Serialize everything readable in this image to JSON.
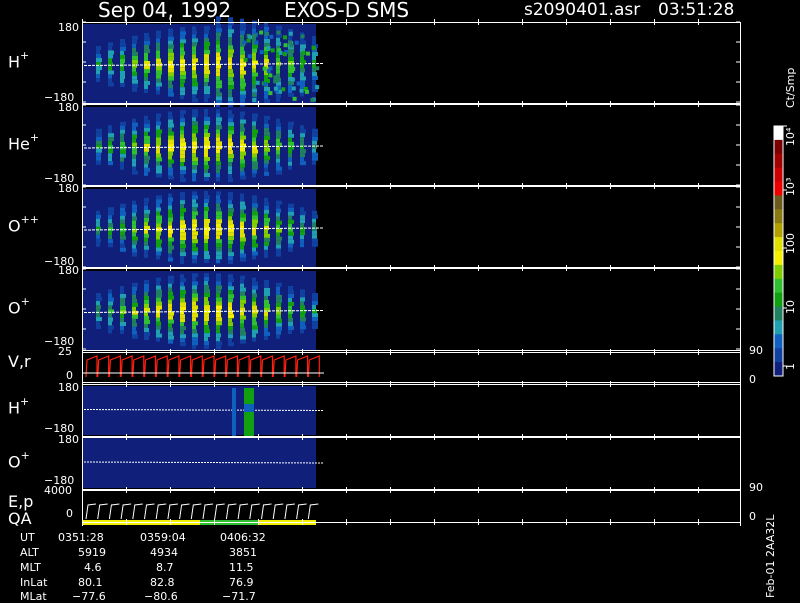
{
  "header": {
    "date": "Sep 04, 1992",
    "instrument": "EXOS-D SMS",
    "file": "s2090401.asr",
    "time": "03:51:28"
  },
  "panels": [
    {
      "species": "H",
      "charge": "+",
      "ymax": "180",
      "ymin": "−180"
    },
    {
      "species": "He",
      "charge": "+",
      "ymax": "180",
      "ymin": "−180"
    },
    {
      "species": "O",
      "charge": "++",
      "ymax": "180",
      "ymin": "−180"
    },
    {
      "species": "O",
      "charge": "+",
      "ymax": "180",
      "ymin": "−180"
    }
  ],
  "vr_panel": {
    "label": "V,r",
    "left_top": "25",
    "left_bottom": "0",
    "right_top": "90",
    "right_bottom": "0"
  },
  "small_panels": [
    {
      "species": "H",
      "charge": "+",
      "ymax": "180",
      "ymin": "−180"
    },
    {
      "species": "O",
      "charge": "+",
      "ymax": "180",
      "ymin": "−180"
    }
  ],
  "ep_panel": {
    "label1": "E,p",
    "label2": "QA",
    "left_top": "4000",
    "left_bottom": "0",
    "right_top": "90",
    "right_bottom": "0"
  },
  "orbit_table": {
    "rows": [
      {
        "label": "UT",
        "values": [
          "0351:28",
          "0359:04",
          "0406:32"
        ]
      },
      {
        "label": "ALT",
        "values": [
          "5919",
          "4934",
          "3851"
        ]
      },
      {
        "label": "MLT",
        "values": [
          "4.6",
          "8.7",
          "11.5"
        ]
      },
      {
        "label": "InLat",
        "values": [
          "80.1",
          "82.8",
          "76.9"
        ]
      },
      {
        "label": "MLat",
        "values": [
          "−77.6",
          "−80.6",
          "−71.7"
        ]
      }
    ]
  },
  "colorbar": {
    "unit": "Ct/Smp",
    "labels": [
      "10⁴",
      "10³",
      "100",
      "10",
      "1"
    ],
    "colors": [
      "#ffffff",
      "#7a0000",
      "#a00000",
      "#cc0000",
      "#ee0000",
      "#6b5a1e",
      "#8a7a10",
      "#b0a000",
      "#e0e000",
      "#f4f000",
      "#7fcf00",
      "#30c030",
      "#10a010",
      "#208060",
      "#20a0b0",
      "#1060c0",
      "#1040a0",
      "#10207a"
    ]
  },
  "footer_id": "Feb-01 2AA32L",
  "colors": {
    "background": "#000000",
    "panel": "#10207a",
    "vr_trace": "#ff2010",
    "qa_bar_yellow": "#f0f000",
    "qa_bar_green": "#30c030"
  }
}
